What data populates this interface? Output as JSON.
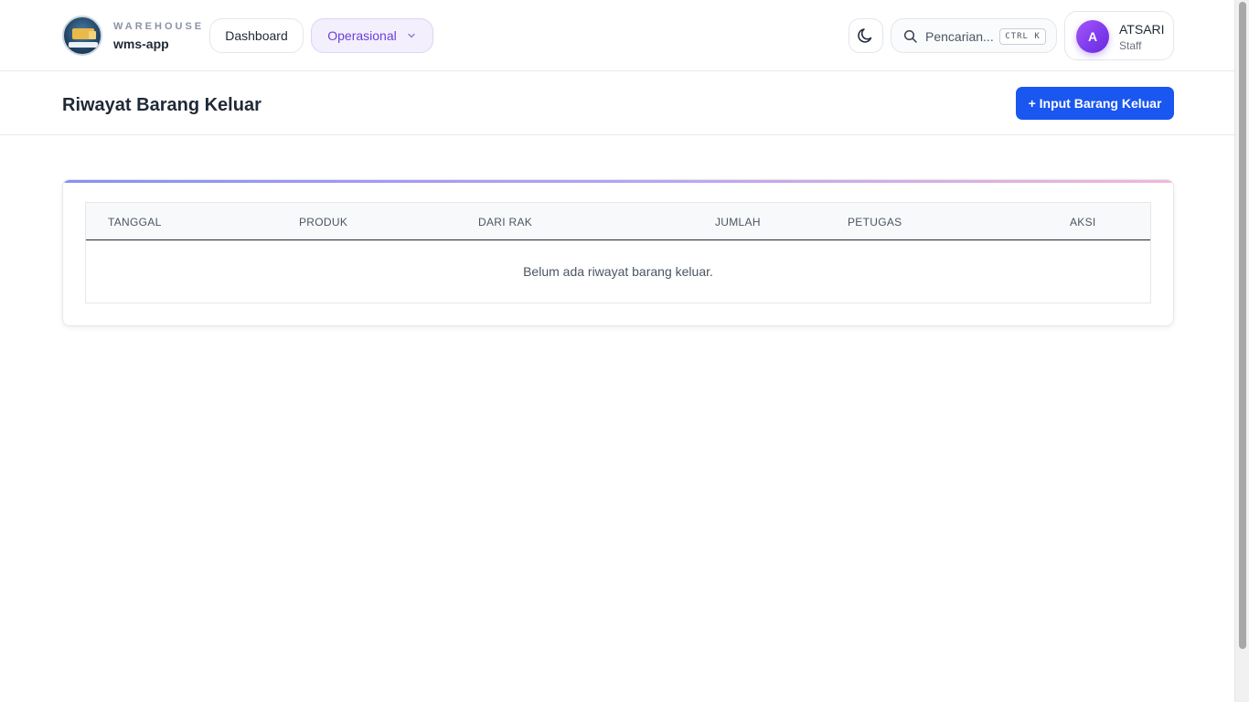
{
  "brand": {
    "subtitle": "WAREHOUSE",
    "name": "wms-app",
    "logo_icon": "warehouse-truck-logo"
  },
  "nav": {
    "dashboard_label": "Dashboard",
    "operasional_label": "Operasional"
  },
  "theme_toggle": {
    "icon": "moon-icon"
  },
  "search": {
    "placeholder": "Pencarian...",
    "shortcut": "CTRL K"
  },
  "user": {
    "initial": "A",
    "name": "ATSARI",
    "role": "Staff"
  },
  "page": {
    "title": "Riwayat Barang Keluar",
    "primary_action": "+ Input Barang Keluar"
  },
  "table": {
    "columns": [
      "TANGGAL",
      "PRODUK",
      "DARI RAK",
      "JUMLAH",
      "PETUGAS",
      "AKSI"
    ],
    "empty_message": "Belum ada riwayat barang keluar."
  },
  "colors": {
    "primary": "#1a56f0",
    "accent_purple": "#6d3fd8",
    "avatar": "#7c3aed"
  }
}
